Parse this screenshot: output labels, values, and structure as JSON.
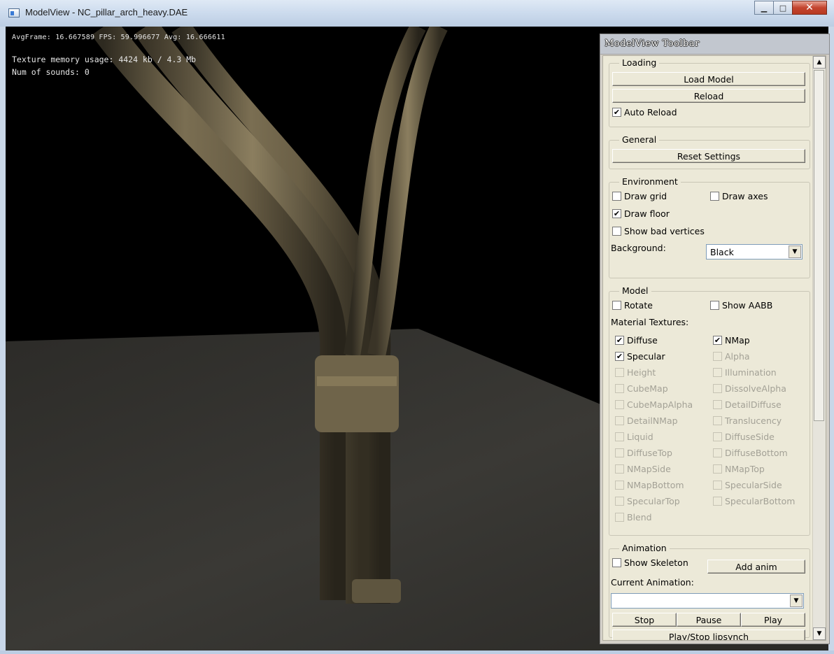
{
  "window": {
    "title": "ModelView - NC_pillar_arch_heavy.DAE",
    "minimize": "▁",
    "maximize": "□",
    "close": "✕"
  },
  "overlay": {
    "frame_stats": "AvgFrame: 16.667589  FPS: 59.996677 Avg: 16.666611",
    "texture_memory": "Texture memory usage: 4424 kb / 4.3 Mb",
    "num_sounds": "Num of sounds: 0"
  },
  "toolbar": {
    "title": "ModelView Toolbar",
    "loading": {
      "legend": "Loading",
      "load_model": "Load Model",
      "reload": "Reload",
      "auto_reload": "Auto Reload"
    },
    "general": {
      "legend": "General",
      "reset_settings": "Reset Settings"
    },
    "environment": {
      "legend": "Environment",
      "draw_grid": "Draw grid",
      "draw_axes": "Draw axes",
      "draw_floor": "Draw floor",
      "show_bad_vertices": "Show bad vertices",
      "background_label": "Background:",
      "background_value": "Black"
    },
    "model": {
      "legend": "Model",
      "rotate": "Rotate",
      "show_aabb": "Show AABB",
      "material_textures": "Material Textures:",
      "textures": [
        "Diffuse",
        "NMap",
        "Specular",
        "Alpha",
        "Height",
        "Illumination",
        "CubeMap",
        "DissolveAlpha",
        "CubeMapAlpha",
        "DetailDiffuse",
        "DetailNMap",
        "Translucency",
        "Liquid",
        "DiffuseSide",
        "DiffuseTop",
        "DiffuseBottom",
        "NMapSide",
        "NMapTop",
        "NMapBottom",
        "SpecularSide",
        "SpecularTop",
        "SpecularBottom",
        "Blend"
      ]
    },
    "animation": {
      "legend": "Animation",
      "show_skeleton": "Show Skeleton",
      "add_anim": "Add anim",
      "current_animation": "Current Animation:",
      "current_value": "",
      "stop": "Stop",
      "pause": "Pause",
      "play": "Play",
      "play_stop_lipsynch": "Play/Stop lipsynch"
    }
  },
  "state": {
    "checked": {
      "auto_reload": true,
      "draw_grid": false,
      "draw_axes": false,
      "draw_floor": true,
      "show_bad_vertices": false,
      "rotate": false,
      "show_aabb": false,
      "show_skeleton": false
    },
    "textures_checked": [
      "Diffuse",
      "NMap",
      "Specular"
    ],
    "textures_enabled": [
      "Diffuse",
      "NMap",
      "Specular"
    ]
  },
  "icons": {
    "check": "✔",
    "scroll_up": "▲",
    "scroll_down": "▼",
    "dropdown": "▼"
  }
}
